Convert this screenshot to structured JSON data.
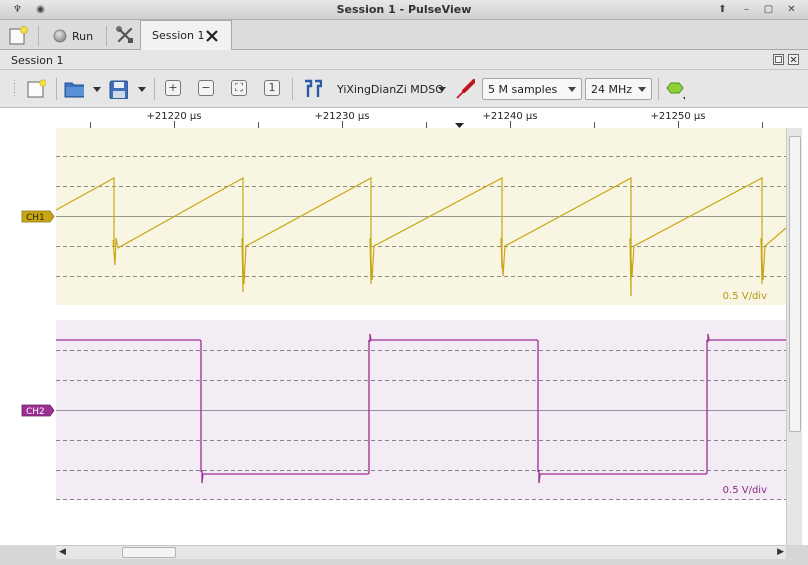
{
  "window": {
    "title": "Session 1 - PulseView"
  },
  "tabbar": {
    "run_label": "Run",
    "session_tab_label": "Session 1"
  },
  "session_header": {
    "label": "Session 1"
  },
  "toolbar": {
    "device": "YiXingDianZi MDSO",
    "samples": "5 M samples",
    "samplerate": "24 MHz"
  },
  "ruler": {
    "ticks": [
      {
        "label": "+21220 µs"
      },
      {
        "label": "+21230 µs"
      },
      {
        "label": "+21240 µs"
      },
      {
        "label": "+21250 µs"
      }
    ]
  },
  "channels": [
    {
      "name": "CH1",
      "scale_label": "0.5 V/div",
      "color": "#c8a615",
      "bg": "#f8f6e3"
    },
    {
      "name": "CH2",
      "scale_label": "0.5 V/div",
      "color": "#9b2f92",
      "bg": "#f3ecf4"
    }
  ]
}
